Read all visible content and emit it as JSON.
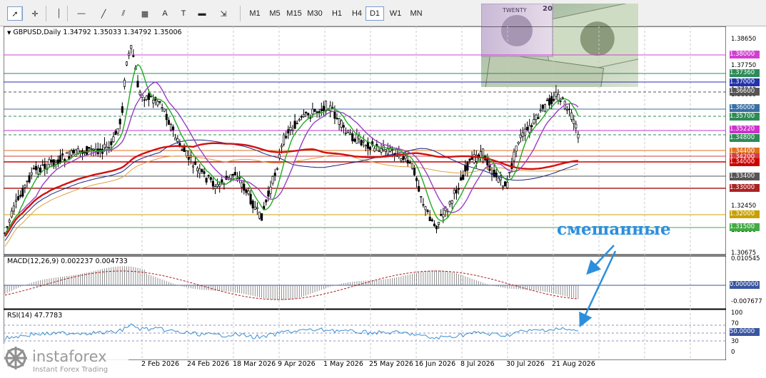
{
  "toolbar": {
    "tools": [
      {
        "name": "cursor-icon",
        "glyph": "➚"
      },
      {
        "name": "crosshair-icon",
        "glyph": "✛"
      },
      {
        "name": "vertical-line-icon",
        "glyph": "│"
      },
      {
        "name": "horizontal-line-icon",
        "glyph": "—"
      },
      {
        "name": "trendline-icon",
        "glyph": "╱"
      },
      {
        "name": "channel-icon",
        "glyph": "⫽"
      },
      {
        "name": "fibonacci-icon",
        "glyph": "▦"
      },
      {
        "name": "text-icon",
        "glyph": "A"
      },
      {
        "name": "text-label-icon",
        "glyph": "T"
      },
      {
        "name": "rectangle-icon",
        "glyph": "▬"
      },
      {
        "name": "arrows-icon",
        "glyph": "⇲"
      }
    ],
    "timeframes": [
      "M1",
      "M5",
      "M15",
      "M30",
      "H1",
      "H4",
      "D1",
      "W1",
      "MN"
    ],
    "active_timeframe": "D1"
  },
  "main": {
    "title": "GBPUSD,Daily  1.34792 1.35033 1.34792 1.35006"
  },
  "macd": {
    "title": "MACD(12,26,9) 0.002237 0.004733"
  },
  "rsi": {
    "title": "RSI(14) 47.7783"
  },
  "price_axis_labels": [
    "1.38650",
    "1.37750",
    "1.37040",
    "1.36660",
    "1.35860",
    "1.35210",
    "1.34440",
    "1.34000",
    "1.33340",
    "1.32450",
    "1.31550",
    "1.30675"
  ],
  "price_levels": [
    {
      "value": "1.38000",
      "color": "#d040d0"
    },
    {
      "value": "1.37360",
      "color": "#2e8b57"
    },
    {
      "value": "1.37000",
      "color": "#2233aa"
    },
    {
      "value": "1.36600",
      "color": "#555555"
    },
    {
      "value": "1.36000",
      "color": "#3a6ea5"
    },
    {
      "value": "1.35700",
      "color": "#2e8b57"
    },
    {
      "value": "1.35220",
      "color": "#cc33cc"
    },
    {
      "value": "1.34800",
      "color": "#2e8b57"
    },
    {
      "value": "1.34400",
      "color": "#e07020"
    },
    {
      "value": "1.34200",
      "color": "#d04040"
    },
    {
      "value": "1.34000",
      "color": "#cc0000"
    },
    {
      "value": "1.33400",
      "color": "#555555"
    },
    {
      "value": "1.33000",
      "color": "#aa2222"
    },
    {
      "value": "1.32000",
      "color": "#c8a000"
    },
    {
      "value": "1.31500",
      "color": "#44aa44"
    }
  ],
  "macd_axis": [
    "0.010545",
    "0.000000",
    "-0.007677"
  ],
  "rsi_axis": [
    "100",
    "70",
    "50.0000",
    "30",
    "0"
  ],
  "date_labels": [
    "2 Feb 2026",
    "24 Feb 2026",
    "18 Mar 2026",
    "9 Apr 2026",
    "1 May 2026",
    "25 May 2026",
    "16 Jun 2026",
    "8 Jul 2026",
    "30 Jul 2026",
    "21 Aug 2026"
  ],
  "annotation": "смешанные",
  "logo": {
    "brand": "instaforex",
    "tagline": "Instant Forex Trading"
  },
  "colors": {
    "bull": "#000000",
    "ma_red": "#d01010",
    "ma_green": "#22aa22",
    "ma_purple": "#9a40c0",
    "ma_navy": "#1a237e",
    "ma_orange": "#e0a040",
    "rsi_line": "#3a8fd0",
    "macd_signal": "#aa1a1a",
    "annotation": "#2d8fdc"
  },
  "photo": {
    "label": "TWENTY",
    "corner": "20"
  }
}
